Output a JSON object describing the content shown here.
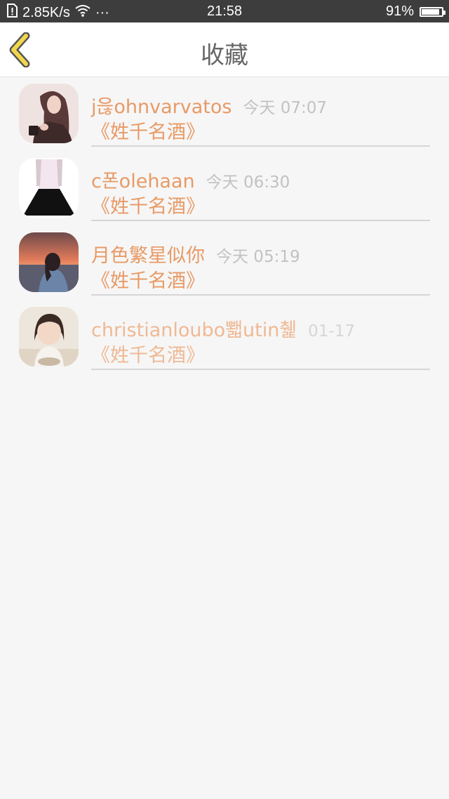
{
  "status_bar": {
    "network_speed": "2.85K/s",
    "more": "···",
    "time": "21:58",
    "battery": "91%",
    "battery_level": 0.91
  },
  "header": {
    "title": "收藏",
    "back_icon": "chevron-left-icon"
  },
  "favorites": [
    {
      "name": "j읂ohnvarvatos",
      "time": "今天 07:07",
      "subtitle": "《姓千名酒》"
    },
    {
      "name": "c폰olehaan",
      "time": "今天 06:30",
      "subtitle": "《姓千名酒》"
    },
    {
      "name": "月色繁星似你",
      "time": "今天 05:19",
      "subtitle": "《姓千名酒》"
    },
    {
      "name": "christianloubo뾃utin췙",
      "time": "01-17",
      "subtitle": "《姓千名酒》"
    }
  ],
  "colors": {
    "accent": "#e89a66",
    "back_arrow_fill": "#f2d64b",
    "time_text": "#c2c2c2"
  }
}
